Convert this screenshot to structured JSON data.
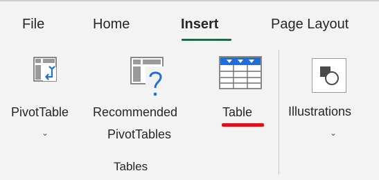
{
  "tabs": {
    "file": "File",
    "home": "Home",
    "insert": "Insert",
    "page_layout": "Page Layout"
  },
  "buttons": {
    "pivottable": {
      "label": "PivotTable",
      "chevron": "⌄"
    },
    "recommended": {
      "line1": "Recommended",
      "line2": "PivotTables"
    },
    "table": {
      "label": "Table"
    },
    "illustrations": {
      "label": "Illustrations",
      "chevron": "⌄"
    }
  },
  "groups": {
    "tables_label": "Tables"
  },
  "colors": {
    "active_tab_underline": "#1e6b43",
    "annotation_underline": "#e0101a",
    "accent_blue": "#1f6fd6"
  },
  "icons": {
    "pivottable": "pivottable-icon",
    "recommended": "recommended-pivottables-icon",
    "table": "table-icon",
    "illustrations": "illustrations-icon"
  }
}
